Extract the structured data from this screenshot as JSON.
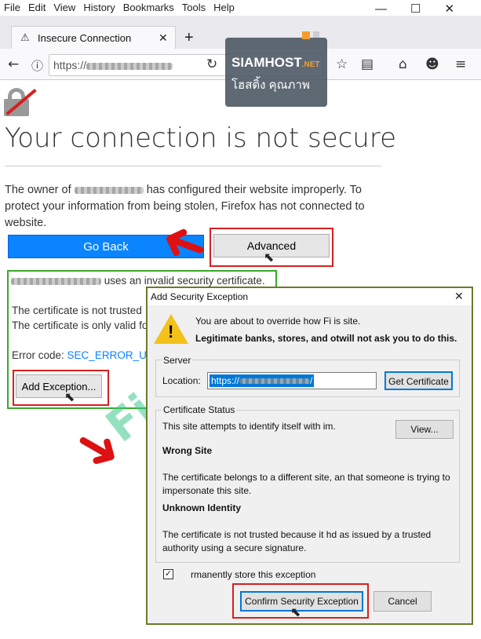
{
  "menu": [
    "File",
    "Edit",
    "View",
    "History",
    "Bookmarks",
    "Tools",
    "Help"
  ],
  "tab": {
    "title": "Insecure Connection"
  },
  "url": {
    "prefix": "https://"
  },
  "watermark": {
    "brand": "SIAMHOST",
    "suffix": ".NET",
    "thai": "โฮสติ้ง คุณภาพ",
    "firefox": "Firefox"
  },
  "error_page": {
    "title": "Your connection is not secure",
    "owner_prefix": "The owner of",
    "owner_suffix": "has configured their website improperly. To protect your information from being stolen, Firefox has not connected to website.",
    "go_back": "Go Back",
    "advanced": "Advanced",
    "invalid_cert": "uses an invalid security certificate.",
    "not_trusted": "The certificate is not trusted",
    "only_valid": "The certificate is only valid fo",
    "error_code_label": "Error code:",
    "error_code": "SEC_ERROR_UNK",
    "add_exception": "Add Exception..."
  },
  "dialog": {
    "title": "Add Security Exception",
    "about": "You are about to override how Fi is site.",
    "legit": "Legitimate banks, stores, and otwill not ask you to do this.",
    "server_label": "Server",
    "location_label": "Location:",
    "location_value": "https://",
    "get_cert": "Get Certificate",
    "status_label": "Certificate Status",
    "identify": "This site attempts to identify itself with im.",
    "view": "View...",
    "wrong_site": "Wrong Site",
    "wrong_desc": "The certificate belongs to a different site, an that someone is trying to impersonate this site.",
    "unknown": "Unknown Identity",
    "unknown_desc": "The certificate is not trusted because it hd as issued by a trusted authority using a secure signature.",
    "store": "rmanently store this exception",
    "confirm": "Confirm Security Exception",
    "cancel": "Cancel"
  },
  "colors": {
    "accent": "#0a84ff",
    "red": "#d71f1f",
    "green": "#3aa82a"
  }
}
